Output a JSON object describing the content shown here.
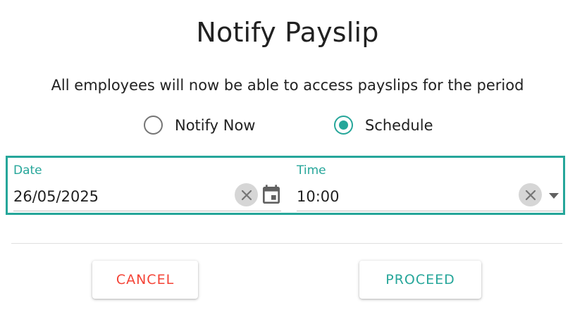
{
  "dialog": {
    "title": "Notify Payslip",
    "subtitle": "All employees will now be able to access payslips for the period"
  },
  "options": {
    "notify_now_label": "Notify Now",
    "schedule_label": "Schedule",
    "selected": "Schedule"
  },
  "date_field": {
    "label": "Date",
    "value": "26/05/2025",
    "clear_icon": "close-icon",
    "picker_icon": "calendar-icon"
  },
  "time_field": {
    "label": "Time",
    "value": "10:00",
    "clear_icon": "close-icon",
    "dropdown_icon": "arrow-drop-down-icon"
  },
  "actions": {
    "cancel_label": "CANCEL",
    "proceed_label": "PROCEED"
  },
  "colors": {
    "accent": "#26a69a",
    "cancel": "#f44336",
    "text": "#212121",
    "radio_unselected": "#757575"
  }
}
